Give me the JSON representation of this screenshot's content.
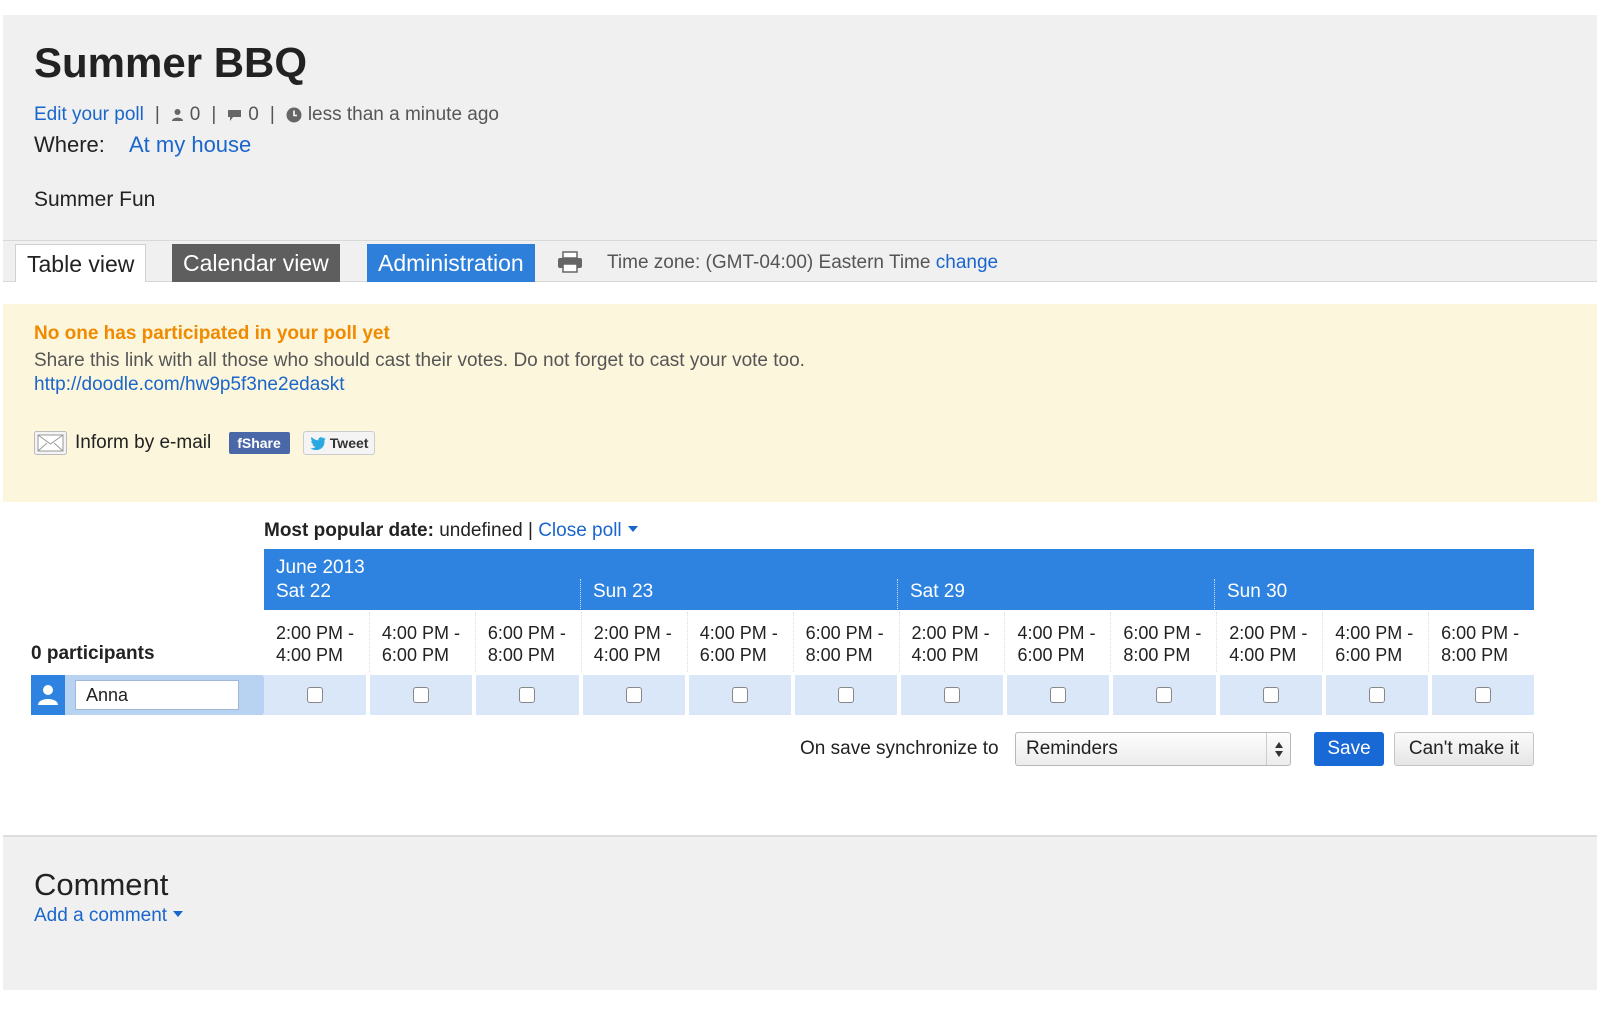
{
  "poll": {
    "title": "Summer BBQ",
    "edit_link": "Edit your poll",
    "participant_count": "0",
    "comment_count": "0",
    "updated": "less than a minute ago",
    "where_label": "Where:",
    "where_value": "At my house",
    "description": "Summer Fun"
  },
  "tabs": {
    "table": "Table view",
    "calendar": "Calendar view",
    "admin": "Administration"
  },
  "timezone": {
    "label": "Time zone: (GMT-04:00) Eastern Time",
    "change": "change"
  },
  "notice": {
    "title": "No one has participated in your poll yet",
    "text": "Share this link with all those who should cast their votes. Do not forget to cast your vote too.",
    "link": "http://doodle.com/hw9p5f3ne2edaskt",
    "inform": "Inform by e-mail",
    "share": "Share",
    "tweet": "Tweet"
  },
  "table": {
    "popular_label": "Most popular date:",
    "popular_value": "undefined",
    "close_poll": "Close poll",
    "month": "June 2013",
    "days": [
      "Sat 22",
      "Sun 23",
      "Sat 29",
      "Sun 30"
    ],
    "slots": [
      [
        "2:00 PM -",
        "4:00 PM"
      ],
      [
        "4:00 PM -",
        "6:00 PM"
      ],
      [
        "6:00 PM -",
        "8:00 PM"
      ],
      [
        "2:00 PM -",
        "4:00 PM"
      ],
      [
        "4:00 PM -",
        "6:00 PM"
      ],
      [
        "6:00 PM -",
        "8:00 PM"
      ],
      [
        "2:00 PM -",
        "4:00 PM"
      ],
      [
        "4:00 PM -",
        "6:00 PM"
      ],
      [
        "6:00 PM -",
        "8:00 PM"
      ],
      [
        "2:00 PM -",
        "4:00 PM"
      ],
      [
        "4:00 PM -",
        "6:00 PM"
      ],
      [
        "6:00 PM -",
        "8:00 PM"
      ]
    ],
    "participants_label": "0 participants",
    "participant_name": "Anna"
  },
  "sync": {
    "label": "On save synchronize to",
    "selected": "Reminders",
    "save": "Save",
    "cant": "Can't make it"
  },
  "comment": {
    "title": "Comment",
    "add": "Add a comment"
  },
  "colors": {
    "accent": "#2e82e0",
    "link": "#1a66cc",
    "warning": "#f08a00",
    "notice_bg": "#fcf6dc"
  }
}
